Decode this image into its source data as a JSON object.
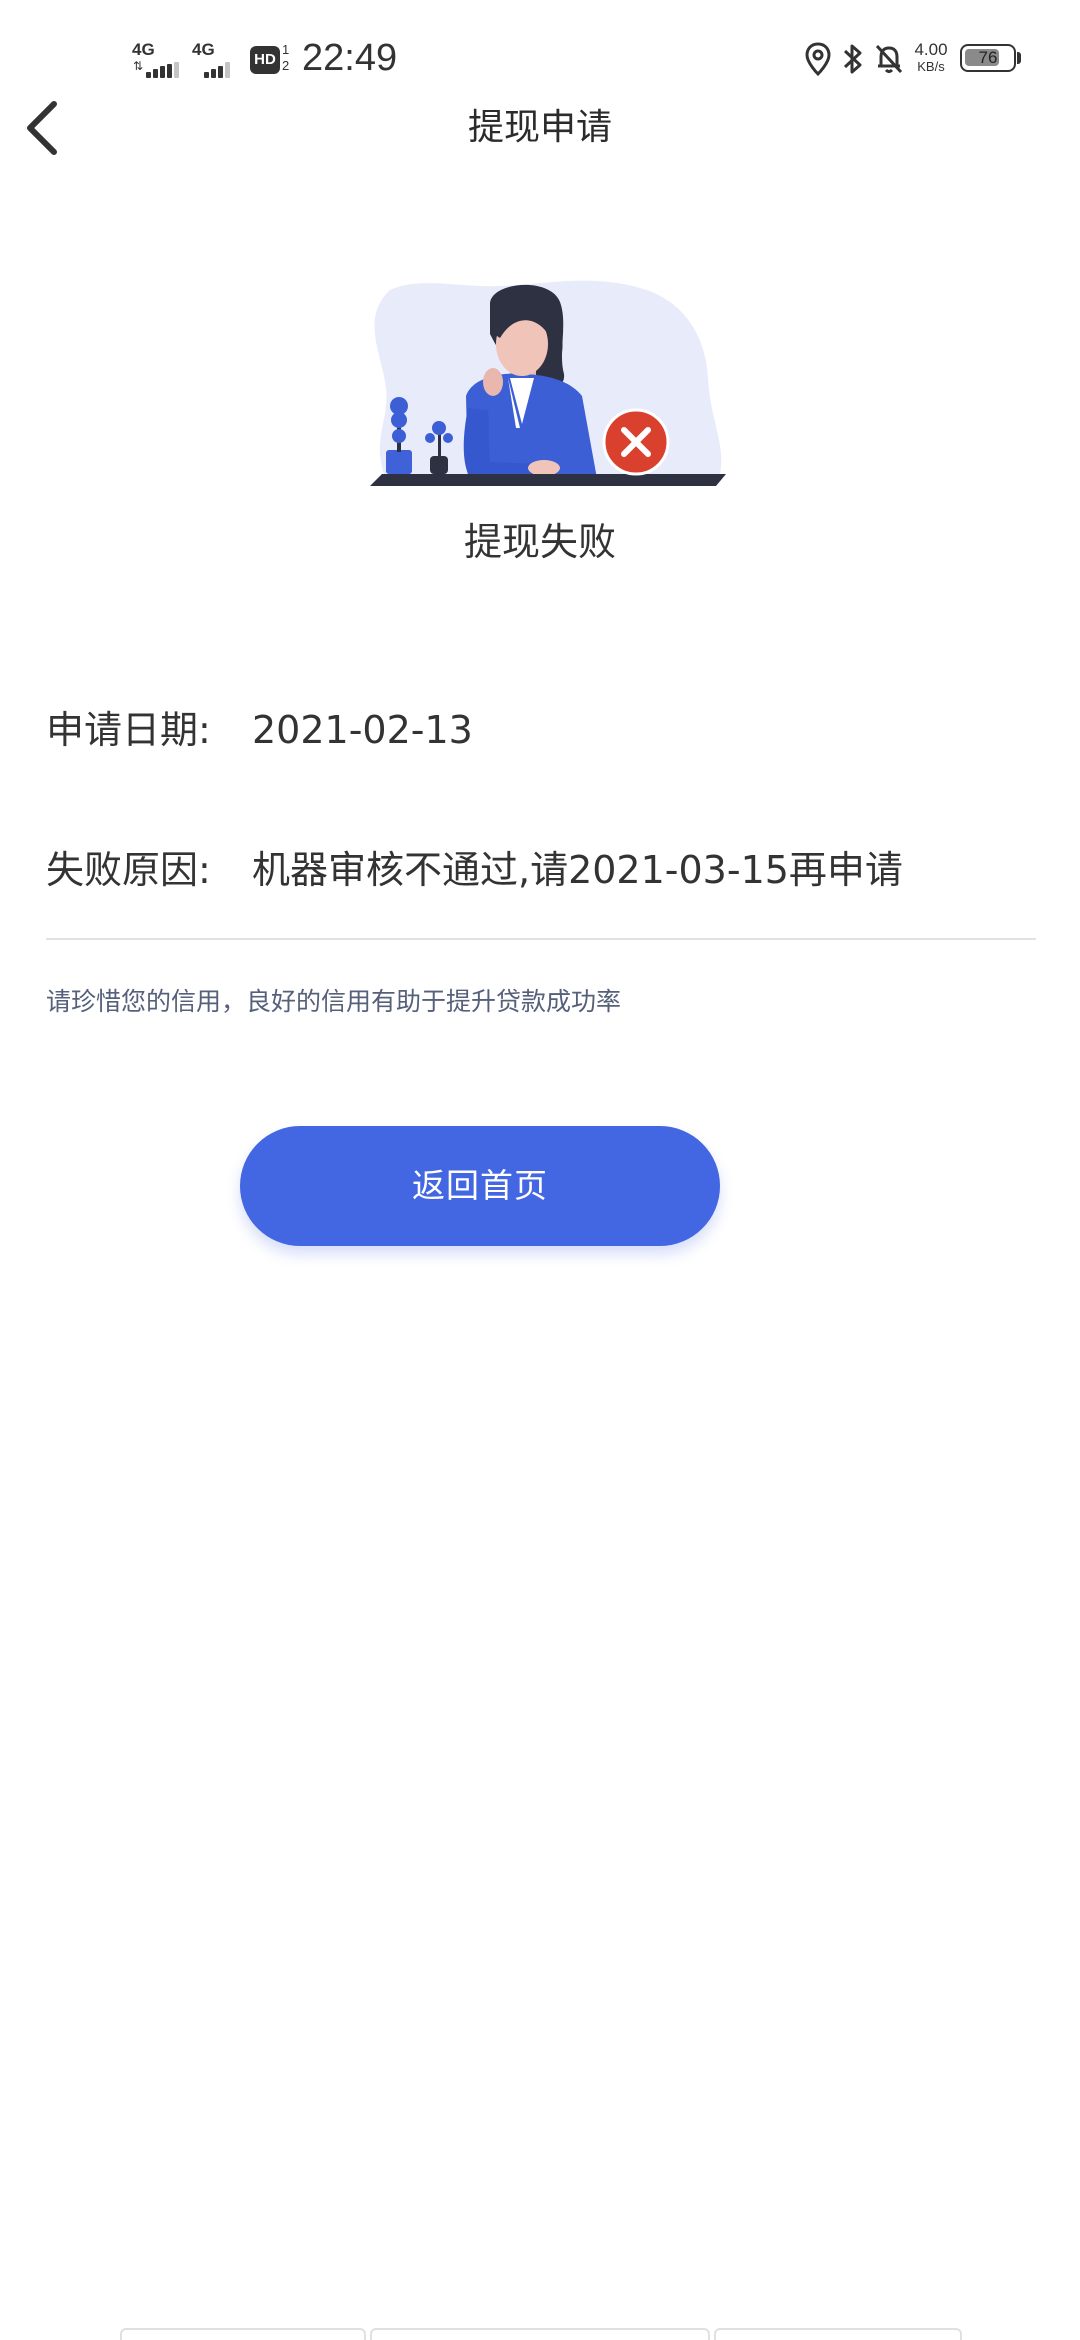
{
  "status_bar": {
    "network_1": "4G",
    "network_2": "4G",
    "hd_label": "HD",
    "hd_slots": "1\n2",
    "time": "22:49",
    "speed_value": "4.00",
    "speed_unit": "KB/s",
    "battery_level": "76",
    "battery_fraction": 0.76,
    "icons": [
      "location-icon",
      "bluetooth-icon",
      "bell-off-icon"
    ]
  },
  "header": {
    "title": "提现申请",
    "back_icon": "chevron-left-icon"
  },
  "result": {
    "illustration": "woman-at-desk-with-error-illustration",
    "badge_icon": "close-icon",
    "title": "提现失败"
  },
  "details": {
    "date_label": "申请日期:",
    "date_value": "2021-02-13",
    "reason_label": "失败原因:",
    "reason_value": "机器审核不通过,请2021-03-15再申请"
  },
  "note": "请珍惜您的信用，良好的信用有助于提升贷款成功率",
  "actions": {
    "home_button": "返回首页"
  },
  "colors": {
    "accent": "#4366e3",
    "error": "#d9402d",
    "note_text": "#56607a"
  }
}
